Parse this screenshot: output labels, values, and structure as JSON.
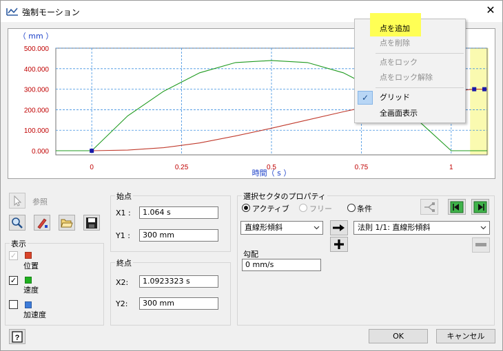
{
  "window": {
    "title": "強制モーション"
  },
  "chart_data": {
    "type": "line",
    "title": "",
    "ylabel": "（ mm ）",
    "xlabel": "時間（ s ）",
    "xlim": [
      -0.1,
      1.1
    ],
    "ylim": [
      -20,
      500
    ],
    "grid": true,
    "x_ticks": [
      0,
      0.25,
      0.5,
      0.75,
      1
    ],
    "x_tick_labels": [
      "0",
      "0.25",
      "0.5",
      "0.75",
      "1"
    ],
    "y_ticks": [
      0,
      100,
      200,
      300,
      400,
      500
    ],
    "y_tick_labels": [
      "0.000",
      "100.000",
      "200.000",
      "300.000",
      "400.000",
      "500.000"
    ],
    "series": [
      {
        "color": "#c0392b",
        "x": [
          -0.1,
          0,
          0.1,
          0.2,
          0.3,
          0.4,
          0.5,
          0.6,
          0.7,
          0.8,
          0.9,
          1.0,
          1.064,
          1.0923,
          1.1
        ],
        "y": [
          0,
          0,
          3,
          15,
          38,
          72,
          110,
          150,
          190,
          228,
          262,
          290,
          300,
          300,
          300
        ]
      },
      {
        "color": "#1e9a1e",
        "x": [
          -0.1,
          0,
          0.1,
          0.2,
          0.3,
          0.4,
          0.5,
          0.6,
          0.7,
          0.8,
          0.9,
          1.0,
          1.1
        ],
        "y": [
          0,
          0,
          170,
          290,
          380,
          430,
          440,
          430,
          380,
          290,
          160,
          0,
          0
        ]
      }
    ],
    "points": [
      {
        "x": 0,
        "y": 0
      },
      {
        "x": 1.064,
        "y": 300
      },
      {
        "x": 1.0923,
        "y": 300
      }
    ],
    "selected_range": [
      1.064,
      1.0923
    ]
  },
  "context_menu": {
    "add_point": "点を追加",
    "delete_point": "点を削除",
    "lock_point": "点をロック",
    "unlock_point": "点をロック解除",
    "grid": "グリッド",
    "grid_checked": true,
    "fit_view": "全画面表示"
  },
  "toolbar": {
    "ref_label": "参照"
  },
  "display": {
    "title": "表示",
    "position": "位置",
    "position_color": "#d9442a",
    "position_checked": true,
    "velocity": "速度",
    "velocity_color": "#20b020",
    "velocity_checked": true,
    "accel": "加速度",
    "accel_color": "#3d7bd9",
    "accel_checked": false
  },
  "start_point": {
    "title": "始点",
    "x_label": "X1 :",
    "x_value": "1.064 s",
    "y_label": "Y1 :",
    "y_value": "300 mm"
  },
  "end_point": {
    "title": "終点",
    "x_label": "X2:",
    "x_value": "1.0923323 s",
    "y_label": "Y2:",
    "y_value": "300 mm"
  },
  "sector": {
    "title": "選択セクタのプロパティ",
    "active": "アクティブ",
    "free": "フリー",
    "condition": "条件",
    "type_value": "直線形傾斜",
    "law_value": "法則 1/1: 直線形傾斜",
    "slope_label": "勾配",
    "slope_value": "0 mm/s"
  },
  "buttons": {
    "ok": "OK",
    "cancel": "キャンセル"
  }
}
